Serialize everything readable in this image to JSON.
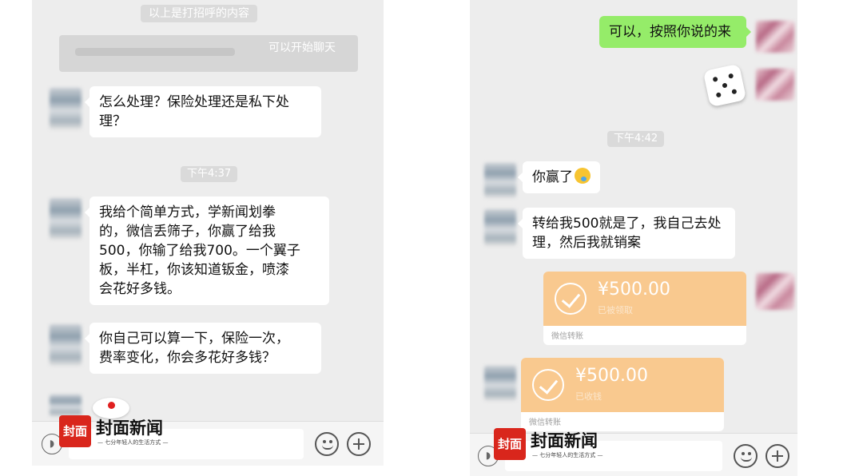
{
  "left_screen": {
    "system_notice": "以上是打招呼的内容",
    "start_chat_hint": "可以开始聊天",
    "messages": [
      {
        "text": "怎么处理？保险处理还是私下处\n理？"
      },
      {
        "text": "我给个简单方式，学新闻划拳\n的，微信丢筛子，你赢了给我\n500，你输了给我700。一个翼子\n板，半杠，你该知道钣金，喷漆\n会花好多钱。"
      },
      {
        "text": "你自己可以算一下，保险一次，\n费率变化，你会多花好多钱？"
      }
    ],
    "timestamp": "下午4:37"
  },
  "right_screen": {
    "messages": [
      {
        "text": "可以，按照你说的来"
      },
      {
        "text": "你赢了"
      },
      {
        "text": "转给我500就是了，我自己去处\n理，然后我就销案"
      }
    ],
    "timestamp": "下午4:42",
    "transfers": [
      {
        "amount": "¥500.00",
        "status": "已被领取",
        "footer": "微信转账"
      },
      {
        "amount": "¥500.00",
        "status": "已收钱",
        "footer": "微信转账"
      }
    ]
  },
  "watermark": {
    "badge": "封面",
    "name": "封面新闻",
    "tagline": "— 七分年轻人的生活方式 —"
  },
  "icons": {
    "voice": "voice-icon",
    "emoji": "emoji-icon",
    "plus": "plus-icon",
    "check": "check-icon",
    "dice": "dice-icon"
  },
  "colors": {
    "chat_background": "#ededed",
    "outgoing_bubble": "#95ec69",
    "transfer_card": "#f9c98f",
    "logo_red": "#d9261c"
  }
}
